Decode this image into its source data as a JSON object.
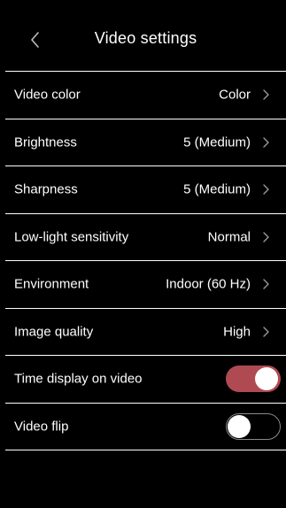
{
  "header": {
    "title": "Video settings",
    "back_icon": "chevron-left-icon"
  },
  "settings": [
    {
      "label": "Video color",
      "value": "Color"
    },
    {
      "label": "Brightness",
      "value": "5 (Medium)"
    },
    {
      "label": "Sharpness",
      "value": "5 (Medium)"
    },
    {
      "label": "Low-light sensitivity",
      "value": "Normal"
    },
    {
      "label": "Environment",
      "value": "Indoor (60 Hz)"
    },
    {
      "label": "Image quality",
      "value": "High"
    }
  ],
  "toggles": [
    {
      "label": "Time display on video",
      "state": "on"
    },
    {
      "label": "Video flip",
      "state": "off"
    }
  ],
  "colors": {
    "background": "#000000",
    "divider": "#ffffff",
    "toggle_on": "#b04a52",
    "toggle_off_border": "#8a8a8a",
    "chevron": "#9a9a9a"
  }
}
